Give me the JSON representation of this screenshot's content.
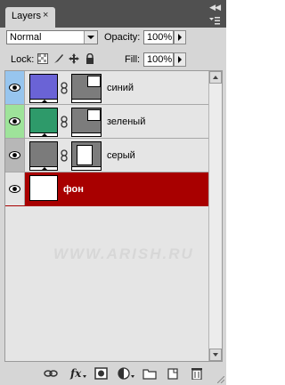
{
  "tab": {
    "label": "Layers",
    "close": "×"
  },
  "blend": {
    "value": "Normal"
  },
  "opacity": {
    "label": "Opacity:",
    "value": "100%"
  },
  "lock": {
    "label": "Lock:"
  },
  "fill": {
    "label": "Fill:",
    "value": "100%"
  },
  "layers": [
    {
      "name": "синий",
      "thumb_color": "#6a63d6",
      "eye_bg": "#97c5ee",
      "row_bg": "#e5e5e5",
      "mask": "swatch"
    },
    {
      "name": "зеленый",
      "thumb_color": "#2e9a6a",
      "eye_bg": "#9ee39a",
      "row_bg": "#e5e5e5",
      "mask": "swatch"
    },
    {
      "name": "серый",
      "thumb_color": "#7b7b7b",
      "eye_bg": "#b7b7b7",
      "row_bg": "#e5e5e5",
      "mask": "white"
    },
    {
      "name": "фон",
      "thumb_color": "#ffffff",
      "eye_bg": "#e5e5e5",
      "row_bg": "#a80000",
      "mask": "none"
    }
  ],
  "watermark": "WWW.ARISH.RU",
  "toolbar_icons": [
    "link-icon",
    "fx-icon",
    "add-mask-icon",
    "adjustment-icon",
    "group-icon",
    "new-layer-icon",
    "trash-icon"
  ]
}
